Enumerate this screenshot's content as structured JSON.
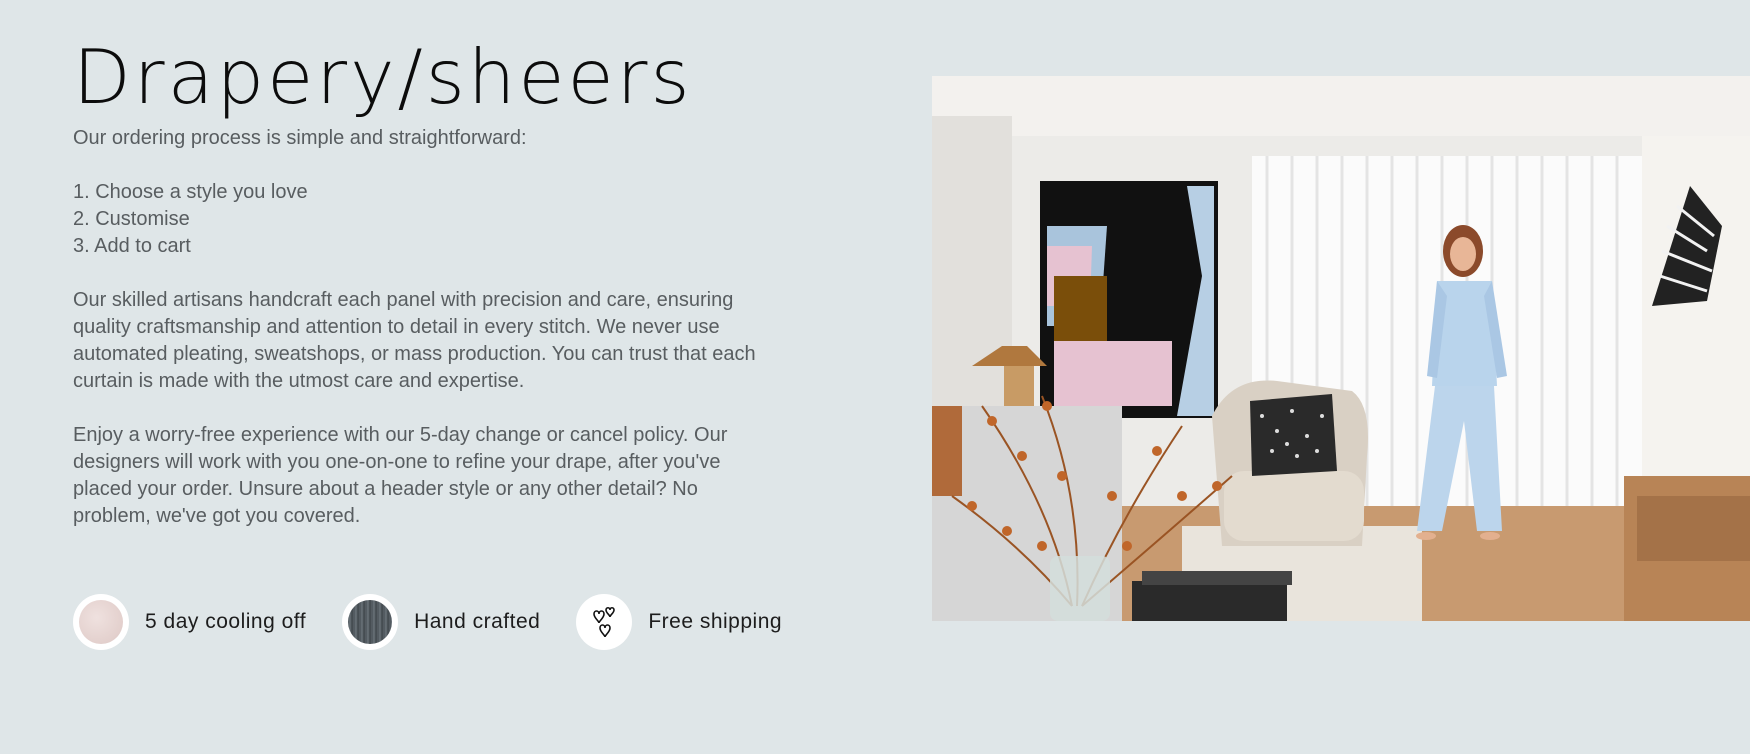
{
  "section": {
    "title": "Drapery/sheers",
    "intro": "Our ordering process is simple and straightforward:",
    "steps": [
      "1. Choose a style you love",
      "2. Customise",
      "3. Add to cart"
    ],
    "craft_text": "Our skilled artisans handcraft each panel with precision and care, ensuring quality craftsmanship and attention to detail in every stitch. We never use automated pleating, sweatshops, or mass production. You can trust that each curtain is made with the utmost care and expertise.",
    "policy_text": "Enjoy a worry-free experience with our 5-day change or cancel policy. Our designers will work with you one-on-one to refine your drape, after you've placed your order. Unsure about a header style or any other detail? No problem, we've got you covered."
  },
  "features": [
    {
      "label": "5 day cooling off",
      "icon": "fabric-swatch-pink-icon"
    },
    {
      "label": "Hand crafted",
      "icon": "fabric-swatch-linen-icon"
    },
    {
      "label": "Free shipping",
      "icon": "hearts-icon"
    }
  ],
  "colors": {
    "background": "#dfe6e8",
    "title": "#0c0c0c",
    "body_text": "#585d60",
    "feature_text": "#1d1d1d"
  }
}
